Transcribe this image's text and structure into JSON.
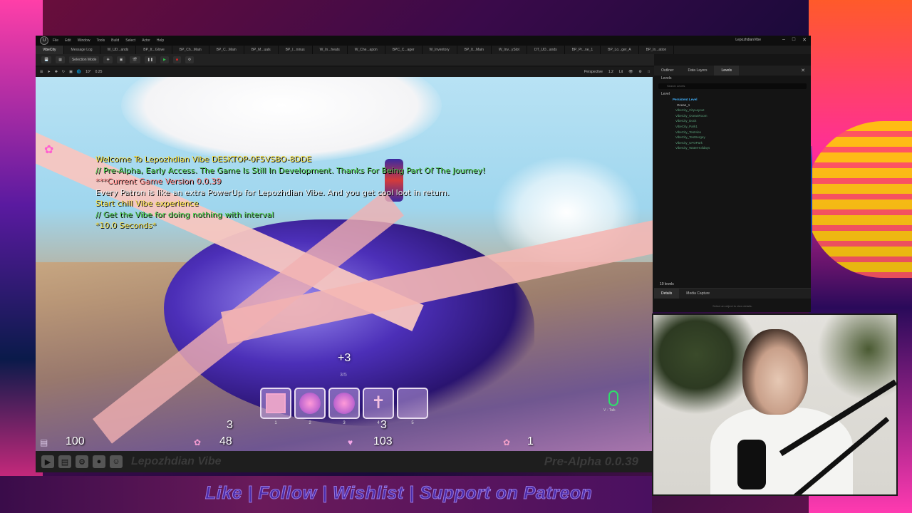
{
  "editor": {
    "menu": [
      "File",
      "Edit",
      "Window",
      "Tools",
      "Build",
      "Select",
      "Actor",
      "Help"
    ],
    "project_name": "LepozhdianVibe",
    "window_controls": [
      "–",
      "□",
      "✕"
    ],
    "tabs": [
      "VibeCity",
      "Message Log",
      "W_UD...ands",
      "BP_It...Glove",
      "BP_Ch...Main",
      "BP_C...Main",
      "BP_M...uals",
      "BP_I...ninus",
      "W_In...heats",
      "W_Che...apon",
      "BPC_C...ager",
      "W_Inventory",
      "BP_It...Main",
      "W_Inv...ySlot",
      "DT_UD...ands",
      "BP_Pr...ne_1",
      "BP_Lo...ger_A",
      "BP_In...ation"
    ],
    "toolbar": {
      "selection_mode": "Selection Mode",
      "play": "▶",
      "pause": "❚❚",
      "stop": "■"
    },
    "viewport_toolbar": {
      "snap_value": "0.25",
      "rotation_snap": "10°",
      "perspective": "Perspective",
      "lit": "Lit",
      "camera_speed": "1.2"
    }
  },
  "log": {
    "welcome": "Welcome To Lepozhdian Vibe DESKTOP-0F5VSBO-8DDE",
    "pre_alpha": "// Pre-Alpha, Early Access. The Game Is Still In Development. Thanks For Being Part Of The Journey!",
    "version": "***Current Game Version 0.0.39",
    "patron": "Every Patron is like an extra PowerUp for Lepozhdian  Vibe. And you get cool loot in return.",
    "chill": "Start chill  Vibe experience",
    "get_vibe": "// Get the Vibe for doing nothing with interval",
    "seconds": "*10.0 Seconds*"
  },
  "hud": {
    "combo": "+3",
    "combo_sub": "3/5",
    "slots": [
      {
        "icon": "expand-icon",
        "num": "1"
      },
      {
        "icon": "orb-icon",
        "num": "2"
      },
      {
        "icon": "orb-icon",
        "num": "3"
      },
      {
        "icon": "totem-icon",
        "num": "4"
      },
      {
        "icon": "empty",
        "num": "5"
      }
    ],
    "slot_count_a": "3",
    "slot_count_b": "3",
    "health": "100",
    "vibe": "48",
    "hearts": "103",
    "lotus": "1",
    "mic_label": "V - Talk"
  },
  "stream": {
    "channel_name": "Lepozhdian Vibe",
    "version": "Pre-Alpha 0.0.39",
    "cta": "Like | Follow | Wishlist | Support on Patreon"
  },
  "outliner": {
    "tabs": [
      "Outliner",
      "Data Layers",
      "Levels"
    ],
    "dropdown": "Levels",
    "search_placeholder": "Search Levels",
    "header": "Level",
    "persistent": "Persistent Level",
    "ocean": "Ocean_1",
    "levels": [
      "VibeCity_CityLayout",
      "VibeCity_OceanRoom",
      "VibeCity_Dock",
      "VibeCity_Park1",
      "VibeCity_TestAlex",
      "VibeCity_TestSergey",
      "VibeCity_UFOPark",
      "VibeCity_WaterHolidays"
    ],
    "footer": "10 levels"
  },
  "details": {
    "tabs": [
      "Details",
      "Media Capture"
    ],
    "hint": "Select an object to view details."
  },
  "colors": {
    "log_yellow": "#f5e04a",
    "log_green": "#4fd04f",
    "log_red": "#ff8a8a",
    "persistent_level": "#43b3ff",
    "play_green": "#2fbf4a",
    "stop_red": "#e22222"
  }
}
